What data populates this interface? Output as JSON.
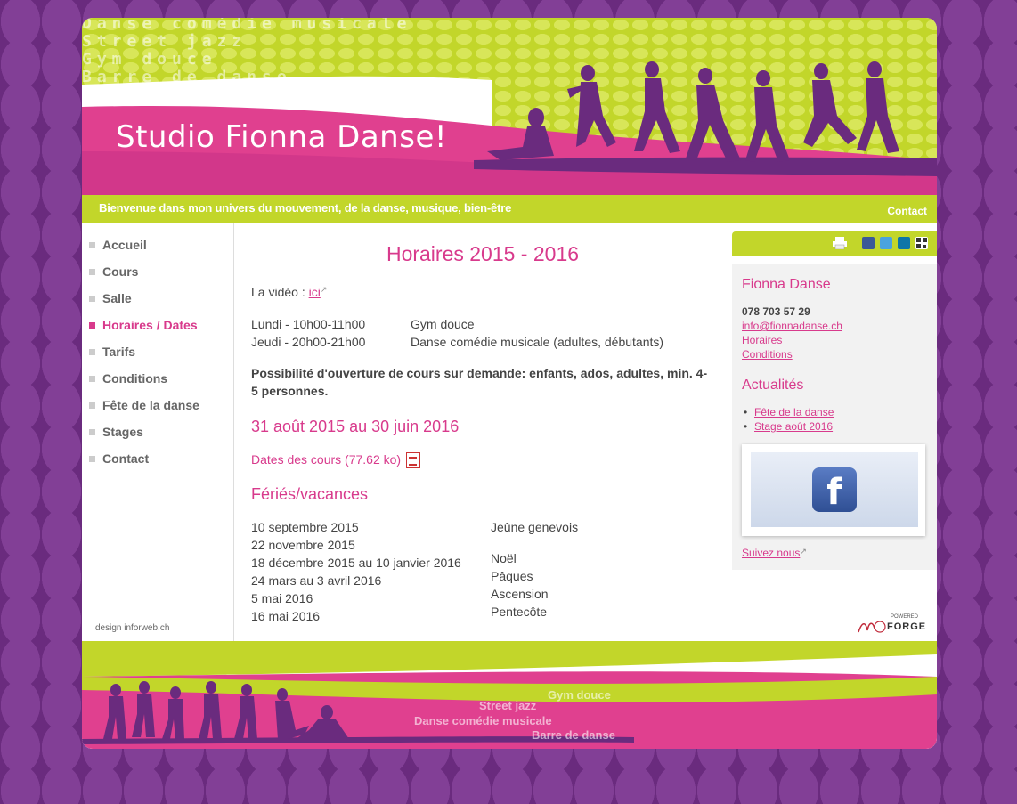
{
  "header": {
    "tagline_words": [
      "Danse comédie musicale",
      "Street jazz",
      "Gym douce",
      "Barre de danse"
    ],
    "site_title": "Studio Fionna Danse!",
    "welcome": "Bienvenue dans mon univers du mouvement, de la danse, musique, bien-être",
    "contact": "Contact"
  },
  "nav": {
    "items": [
      {
        "label": "Accueil"
      },
      {
        "label": "Cours"
      },
      {
        "label": "Salle"
      },
      {
        "label": "Horaires / Dates",
        "active": true
      },
      {
        "label": "Tarifs"
      },
      {
        "label": "Conditions"
      },
      {
        "label": "Fête de la danse"
      },
      {
        "label": "Stages"
      },
      {
        "label": "Contact"
      }
    ],
    "credit": "design inforweb.ch"
  },
  "main": {
    "title": "Horaires 2015 - 2016",
    "video_label": "La vidéo : ",
    "video_link": "ici",
    "schedule": [
      {
        "time": "Lundi - 10h00-11h00",
        "course": "Gym douce"
      },
      {
        "time": "Jeudi - 20h00-21h00",
        "course": "Danse comédie musicale (adultes, débutants)"
      }
    ],
    "note_line1": "Possibilité d'ouverture de cours sur demande: enfants, ados, adultes, min. 4-",
    "note_line2": "5 personnes.",
    "period_heading": "31 août 2015 au 30 juin 2016",
    "dates_link": "Dates des cours (77.62 ko)",
    "holidays_heading": "Fériés/vacances",
    "holiday_dates": [
      "10 septembre 2015",
      "22 novembre 2015",
      "18 décembre 2015 au 10 janvier 2016",
      "24 mars au 3 avril 2016",
      "5 mai 2016",
      "16 mai 2016"
    ],
    "holiday_names": [
      "Jeûne genevois",
      "Noël",
      "Pâques",
      "Ascension",
      "Pentecôte"
    ]
  },
  "sidebar": {
    "name_heading": "Fionna Danse",
    "phone": "078 703 57 29",
    "email": "info@fionnadanse.ch",
    "links": [
      "Horaires",
      "Conditions"
    ],
    "news_heading": "Actualités",
    "news": [
      "Fête de la danse",
      "Stage août 2016"
    ],
    "follow": "Suivez nous",
    "fb_letter": "f"
  },
  "footer": {
    "words": [
      "Gym douce",
      "Street jazz",
      "Danse comédie musicale",
      "Barre de danse"
    ],
    "powered_small": "POWERED",
    "powered_brand": "FORGE"
  },
  "colors": {
    "accent_pink": "#d83a8c",
    "lime": "#c2d62a",
    "purple": "#6a2b7e"
  }
}
